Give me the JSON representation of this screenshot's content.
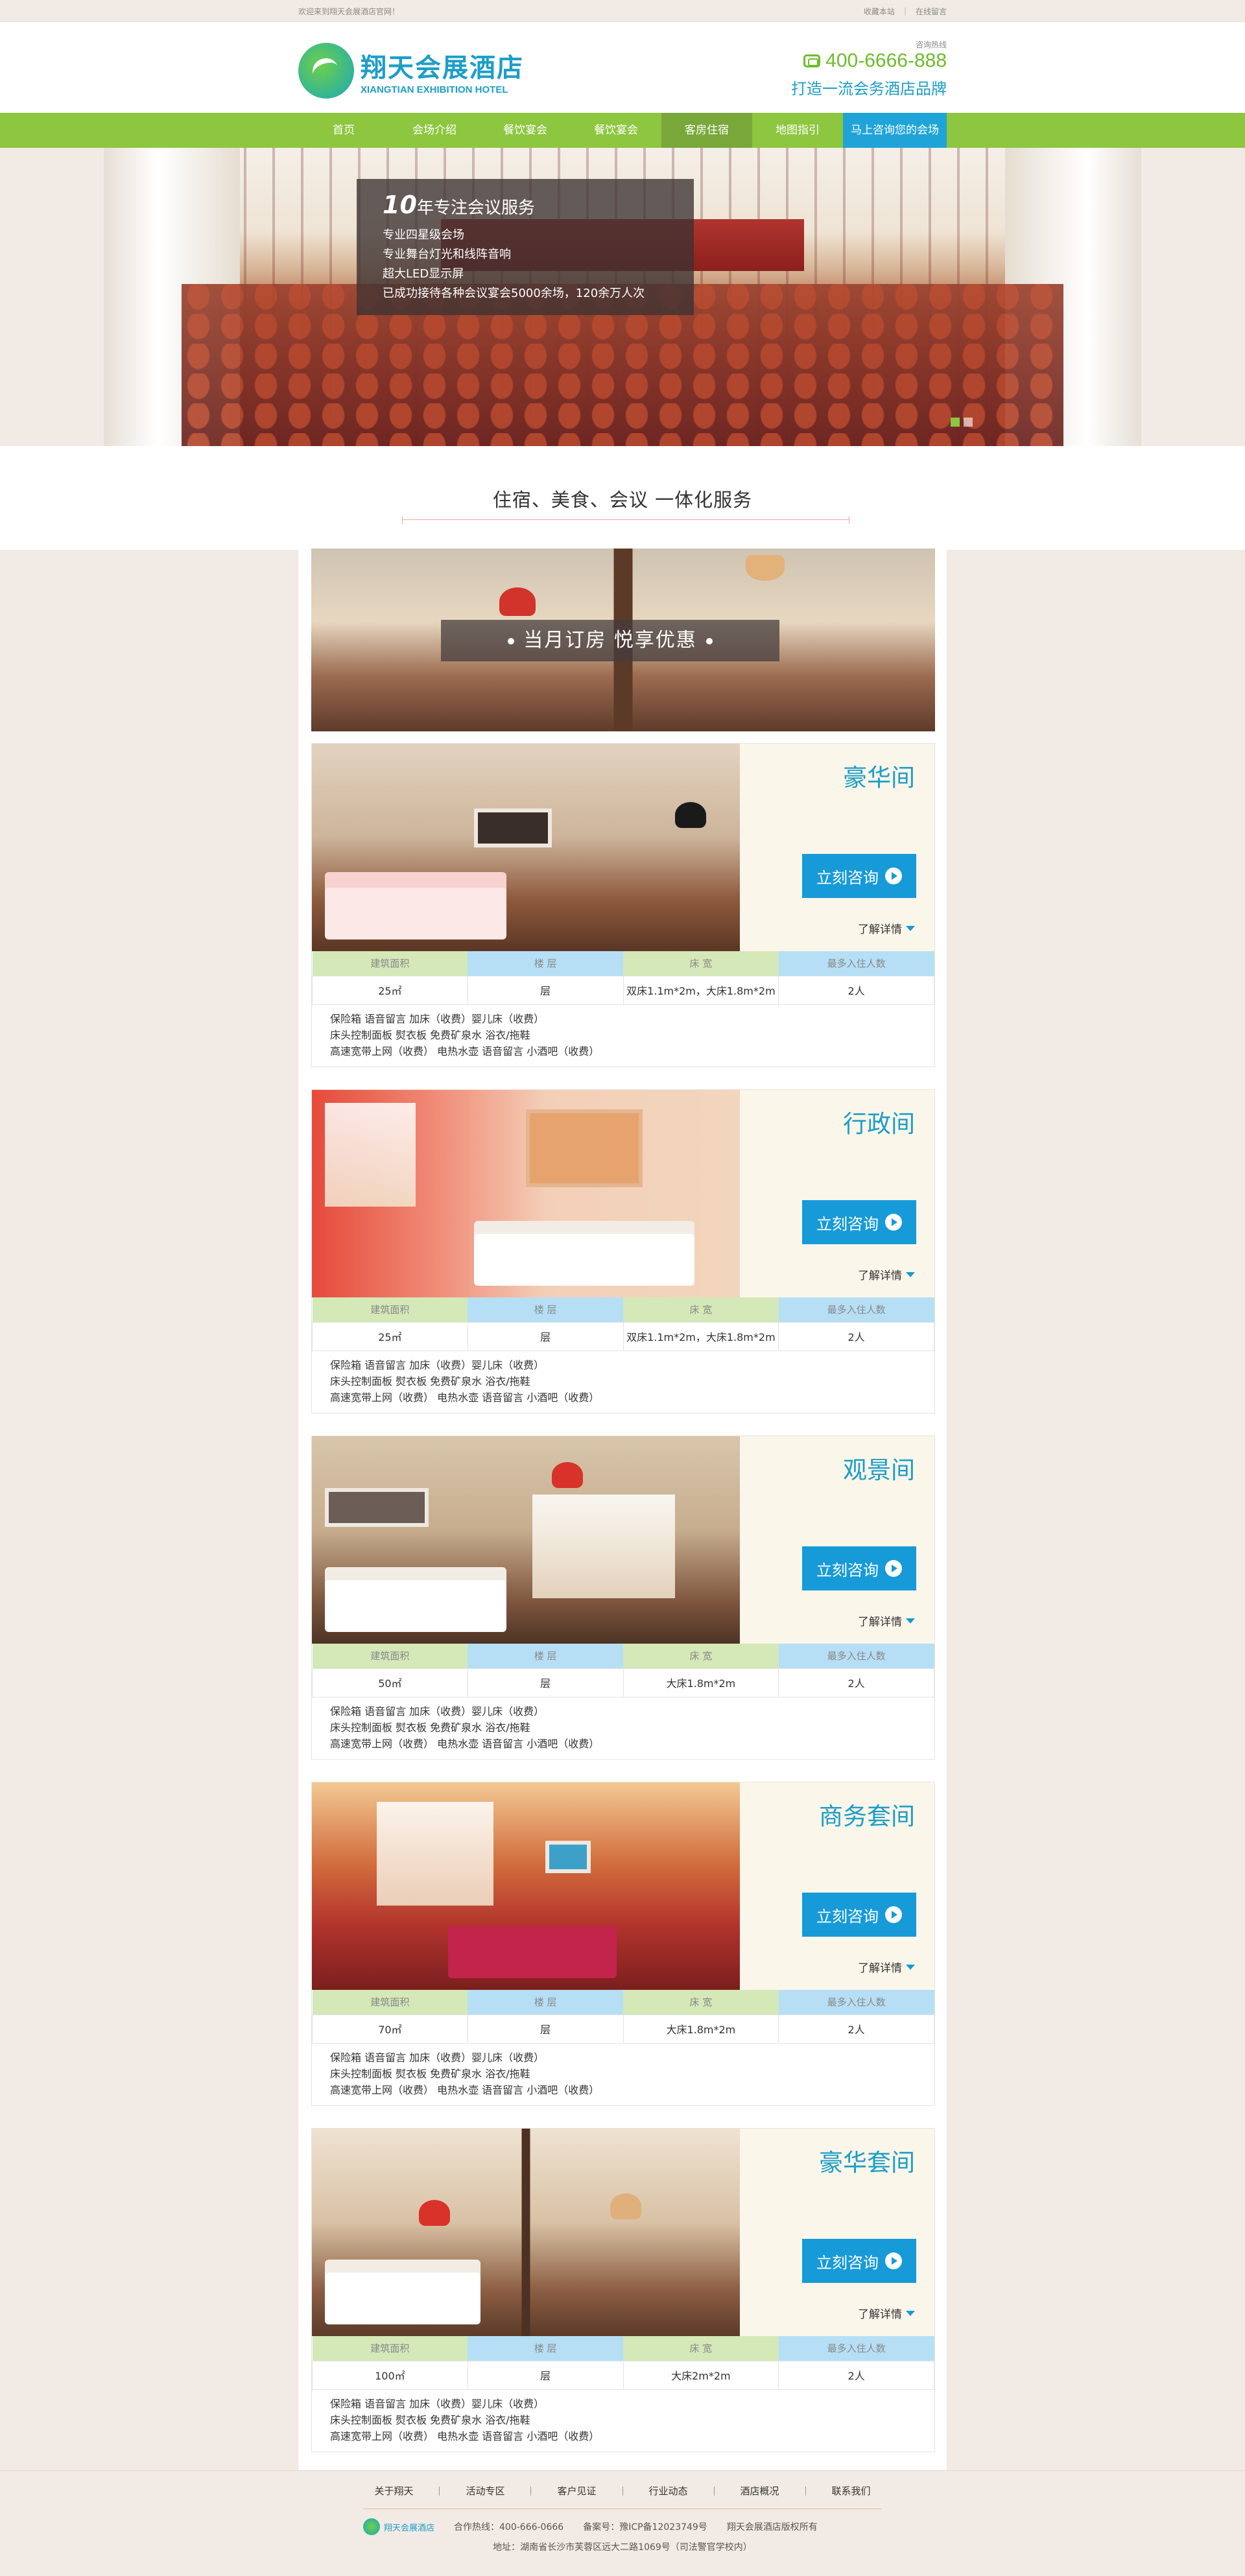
{
  "topbar": {
    "welcome": "欢迎来到翔天会展酒店官网！",
    "favorite": "收藏本站",
    "sep": "|",
    "online": "在线留言"
  },
  "header": {
    "logo_cn": "翔天会展酒店",
    "logo_en": "XIANGTIAN EXHIBITION HOTEL",
    "hotline_label": "咨询热线",
    "hotline": "400-6666-888",
    "slogan": "打造一流会务酒店品牌"
  },
  "nav": {
    "items": [
      "首页",
      "会场介绍",
      "餐饮宴会",
      "餐饮宴会",
      "客房住宿",
      "地图指引"
    ],
    "cta": "马上咨询您的会场",
    "active_index": 4
  },
  "banner": {
    "title_num": "10",
    "title_rest": "年专注会议服务",
    "points": [
      "专业四星级会场",
      "专业舞台灯光和线阵音响",
      "超大LED显示屏",
      "已成功接待各种会议宴会5000余场，120余万人次"
    ]
  },
  "section": {
    "title": "住宿、美食、会议 一体化服务"
  },
  "promo": {
    "text": "当月订房 悦享优惠"
  },
  "table_headers": [
    "建筑面积",
    "楼  层",
    "床  宽",
    "最多入住人数"
  ],
  "consult_label": "立刻咨询",
  "more_label": "了解详情",
  "rooms": [
    {
      "name": "豪华间",
      "area": "25㎡",
      "floor": "层",
      "bed": "双床1.1m*2m，大床1.8m*2m",
      "guests": "2人",
      "amenities": [
        "保险箱 语音留言 加床（收费）婴儿床（收费）",
        "床头控制面板 熨衣板 免费矿泉水 浴衣/拖鞋",
        "高速宽带上网（收费） 电热水壶 语音留言 小酒吧（收费）"
      ]
    },
    {
      "name": "行政间",
      "area": "25㎡",
      "floor": "层",
      "bed": "双床1.1m*2m，大床1.8m*2m",
      "guests": "2人",
      "amenities": [
        "保险箱 语音留言 加床（收费）婴儿床（收费）",
        "床头控制面板 熨衣板 免费矿泉水 浴衣/拖鞋",
        "高速宽带上网（收费） 电热水壶 语音留言 小酒吧（收费）"
      ]
    },
    {
      "name": "观景间",
      "area": "50㎡",
      "floor": "层",
      "bed": "大床1.8m*2m",
      "guests": "2人",
      "amenities": [
        "保险箱 语音留言 加床（收费）婴儿床（收费）",
        "床头控制面板 熨衣板 免费矿泉水 浴衣/拖鞋",
        "高速宽带上网（收费） 电热水壶 语音留言 小酒吧（收费）"
      ]
    },
    {
      "name": "商务套间",
      "area": "70㎡",
      "floor": "层",
      "bed": "大床1.8m*2m",
      "guests": "2人",
      "amenities": [
        "保险箱 语音留言 加床（收费）婴儿床（收费）",
        "床头控制面板 熨衣板 免费矿泉水 浴衣/拖鞋",
        "高速宽带上网（收费） 电热水壶 语音留言 小酒吧（收费）"
      ]
    },
    {
      "name": "豪华套间",
      "area": "100㎡",
      "floor": "层",
      "bed": "大床2m*2m",
      "guests": "2人",
      "amenities": [
        "保险箱 语音留言 加床（收费）婴儿床（收费）",
        "床头控制面板 熨衣板 免费矿泉水 浴衣/拖鞋",
        "高速宽带上网（收费） 电热水壶 语音留言 小酒吧（收费）"
      ]
    }
  ],
  "footer": {
    "links": [
      "关于翔天",
      "活动专区",
      "客户见证",
      "行业动态",
      "酒店概况",
      "联系我们"
    ],
    "logo_text": "翔天会展酒店",
    "hotline": "合作热线：400-666-0666",
    "icp": "备案号：豫ICP备12023749号",
    "copyright": "翔天会展酒店版权所有",
    "address": "地址：湖南省长沙市芙蓉区远大二路1069号（司法警官学校内）"
  },
  "colors": {
    "nav_green": "#8dc63f",
    "brand_blue": "#1c9ec7",
    "button_blue": "#179ad8",
    "page_bg": "#f2ebe5"
  }
}
